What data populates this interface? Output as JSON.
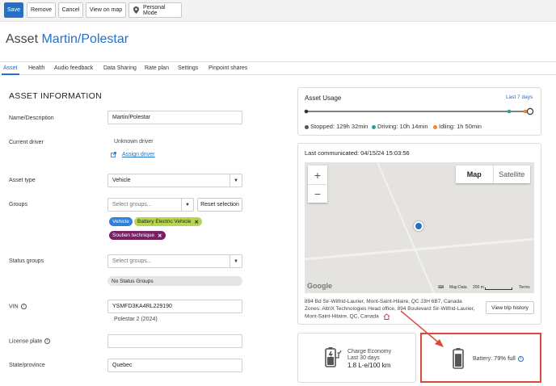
{
  "toolbar": {
    "save_label": "Save",
    "remove_label": "Remove",
    "cancel_label": "Cancel",
    "view_on_map_label": "View on map",
    "personal_mode_label": "Personal Mode"
  },
  "header": {
    "title_prefix": "Asset",
    "title_name": "Martin/Polestar"
  },
  "tabs": [
    {
      "label": "Asset"
    },
    {
      "label": "Health"
    },
    {
      "label": "Audio feedback"
    },
    {
      "label": "Data Sharing"
    },
    {
      "label": "Rate plan"
    },
    {
      "label": "Settings"
    },
    {
      "label": "Pinpoint shares"
    }
  ],
  "form": {
    "section_title": "ASSET INFORMATION",
    "name_label": "Name/Description",
    "name_value": "Martin/Polestar",
    "driver_label": "Current driver",
    "driver_value": "Unknown driver",
    "assign_driver_label": "Assign driver",
    "asset_type_label": "Asset type",
    "asset_type_value": "Vehicle",
    "groups_label": "Groups",
    "groups_placeholder": "Select groups...",
    "reset_selection_label": "Reset selection",
    "group_chips": [
      "Vehicle",
      "Battery Electric Vehicle",
      "Soutien technique"
    ],
    "status_groups_label": "Status groups",
    "status_groups_placeholder": "Select groups...",
    "no_status_groups": "No Status Groups",
    "vin_label": "VIN",
    "vin_value": "YSMFD3KA4RL229190",
    "vin_decoded": "Polestar 2 (2024)",
    "license_label": "License plate",
    "license_value": "",
    "state_label": "State/province",
    "state_value": "Quebec"
  },
  "usage": {
    "title": "Asset Usage",
    "range": "Last 7 days",
    "stopped_label": "Stopped:",
    "stopped_value": "129h 32min",
    "driving_label": "Driving:",
    "driving_value": "10h 14min",
    "idling_label": "Idling:",
    "idling_value": "1h 50min",
    "colors": {
      "stopped": "#555555",
      "driving": "#2aa198",
      "idling": "#e8873a"
    }
  },
  "location": {
    "last_communicated": "Last communicated: 04/15/24 15:03:56",
    "map_label": "Map",
    "satellite_label": "Satellite",
    "zoom_in": "+",
    "zoom_out": "−",
    "google_logo": "Google",
    "map_data": "Map Data",
    "scale": "200 m",
    "terms": "Terms",
    "address_line": "894 Bd Sir-Wilfrid-Laurier, Mont-Saint-Hilaire, QC J3H 6B7, Canada",
    "zones_line1": "Zones: AltriX Technologies Head office, 894 Boulevard Sir-Wilfrid-Laurier,",
    "zones_line2": "Mont-Saint-Hilaire, QC, Canada",
    "view_trip_history": "View trip history"
  },
  "charge": {
    "title": "Charge Economy",
    "period": "Last 30 days",
    "value": "1.8 L-e/100 km"
  },
  "battery": {
    "label": "Battery:",
    "value": "79% full",
    "level": 0.79
  }
}
